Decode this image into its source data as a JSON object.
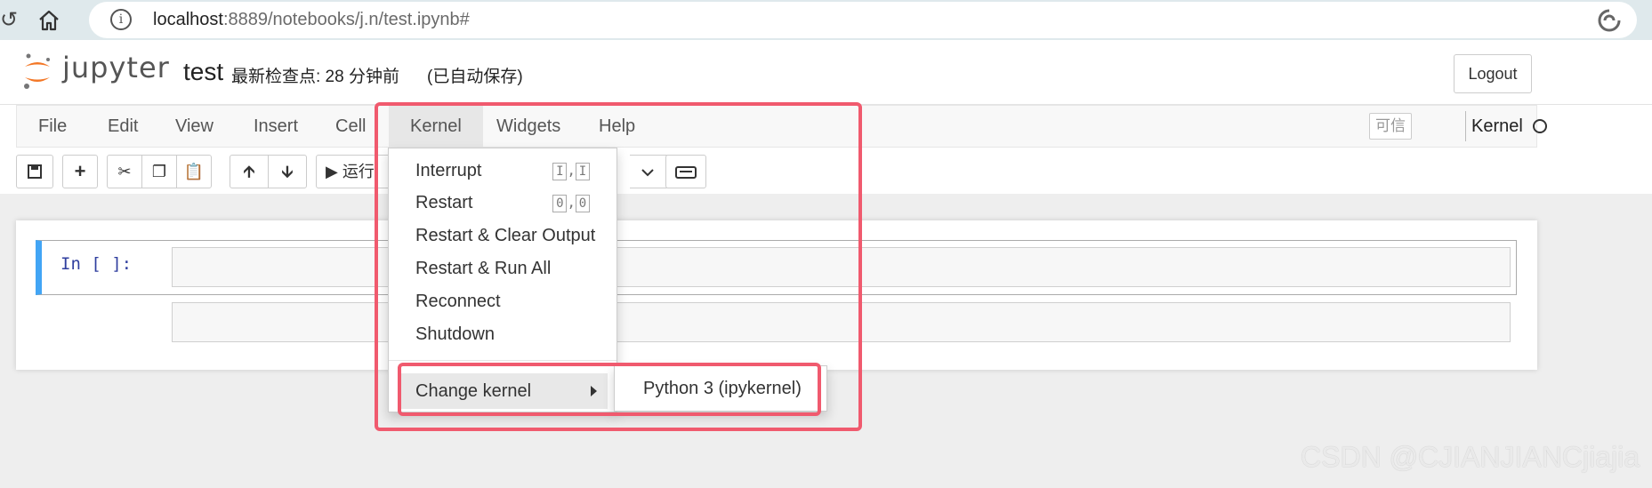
{
  "browser": {
    "url_host": "localhost",
    "url_rest": ":8889/notebooks/j.n/test.ipynb#"
  },
  "header": {
    "logo_text": "jupyter",
    "notebook_title": "test",
    "checkpoint": "最新检查点: 28 分钟前",
    "autosave": "(已自动保存)",
    "logout_label": "Logout"
  },
  "menubar": {
    "items": [
      "File",
      "Edit",
      "View",
      "Insert",
      "Cell",
      "Kernel",
      "Widgets",
      "Help"
    ],
    "trusted_label": "可信",
    "kernel_label": "Kernel"
  },
  "toolbar": {
    "run_label": "运行"
  },
  "cell": {
    "prompt": "In  [ ]:"
  },
  "kernel_menu": {
    "items": [
      {
        "label": "Interrupt",
        "shortcut": [
          "I",
          "I"
        ]
      },
      {
        "label": "Restart",
        "shortcut": [
          "0",
          "0"
        ]
      },
      {
        "label": "Restart & Clear Output"
      },
      {
        "label": "Restart & Run All"
      },
      {
        "label": "Reconnect"
      },
      {
        "label": "Shutdown"
      }
    ],
    "change_kernel_label": "Change kernel",
    "kernel_options": [
      "Python 3 (ipykernel)"
    ]
  },
  "watermark": "CSDN @CJIANJIANCjiajia",
  "colors": {
    "highlight": "#f05a6e",
    "cell_selected_bar": "#42a5f5",
    "jupyter_orange": "#f37726"
  }
}
